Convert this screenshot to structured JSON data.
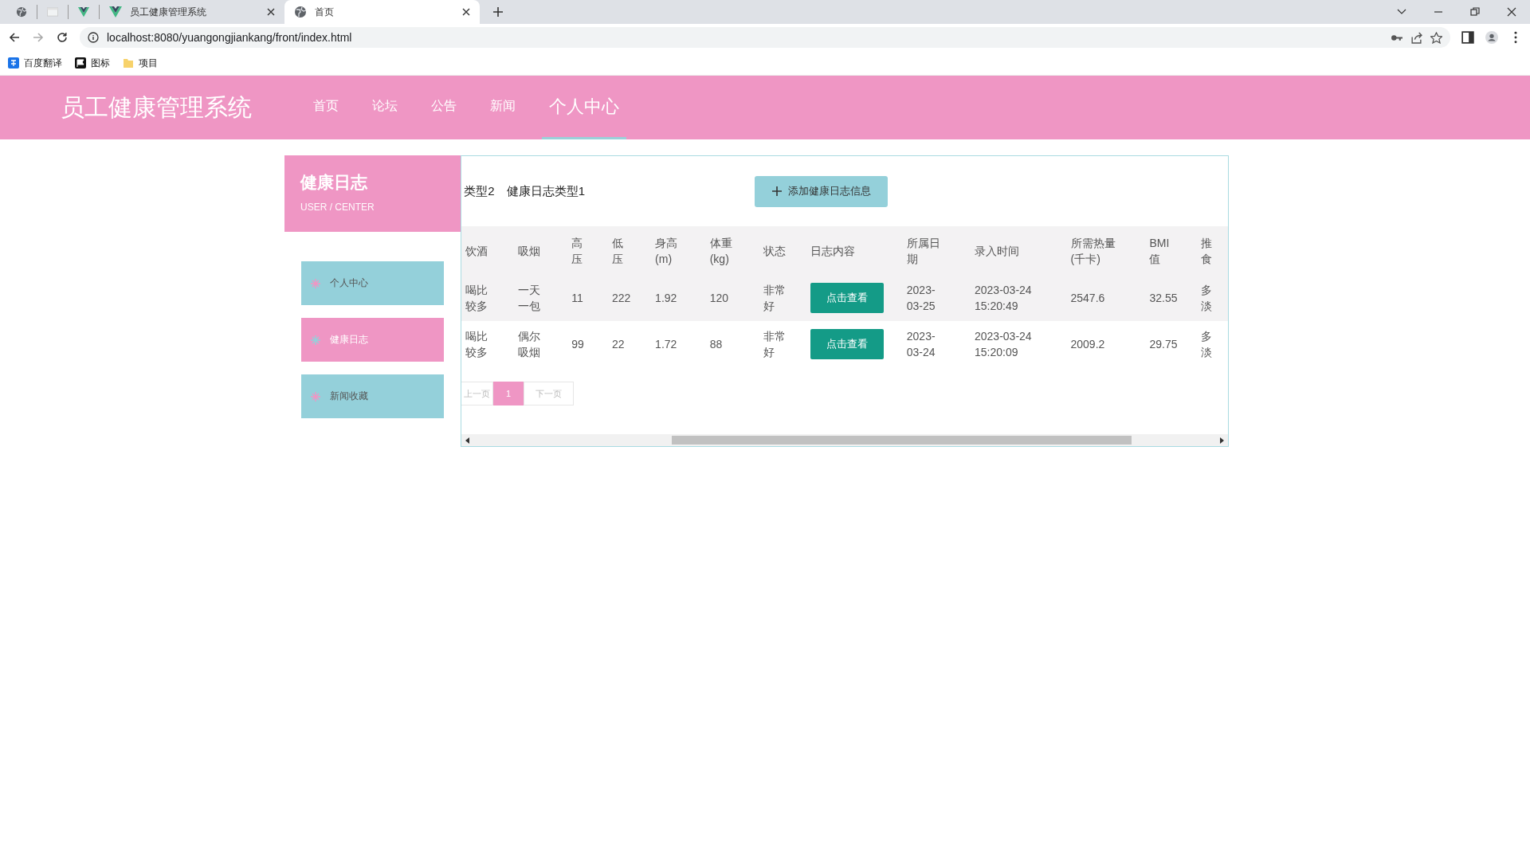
{
  "browser": {
    "tabs": [
      {
        "kind": "globe",
        "selected": false
      },
      {
        "kind": "blank",
        "selected": false
      },
      {
        "kind": "vue",
        "selected": false
      },
      {
        "kind": "vue",
        "title": "员工健康管理系统",
        "selected": false
      },
      {
        "kind": "globe",
        "title": "首页",
        "selected": true
      }
    ],
    "address": "localhost:8080/yuangongjiankang/front/index.html",
    "bookmarks": [
      {
        "kind": "translate",
        "label": "百度翻译"
      },
      {
        "kind": "flag",
        "label": "图标"
      },
      {
        "kind": "folder",
        "label": "项目"
      }
    ]
  },
  "site": {
    "title": "员工健康管理系统",
    "nav": [
      {
        "label": "首页",
        "selected": false
      },
      {
        "label": "论坛",
        "selected": false
      },
      {
        "label": "公告",
        "selected": false
      },
      {
        "label": "新闻",
        "selected": false
      },
      {
        "label": "个人中心",
        "selected": true
      }
    ]
  },
  "sidebar": {
    "title": "健康日志",
    "subtitle": "USER / CENTER",
    "items": [
      {
        "label": "个人中心",
        "selected": false
      },
      {
        "label": "健康日志",
        "selected": true
      },
      {
        "label": "新闻收藏",
        "selected": false
      }
    ]
  },
  "panel": {
    "filters": [
      "类型2",
      "健康日志类型1"
    ],
    "add_button": "添加健康日志信息",
    "table": {
      "columns": [
        {
          "label": "饮酒",
          "kind": "text"
        },
        {
          "label": "吸烟",
          "kind": "text"
        },
        {
          "label": "高压",
          "kind": "text"
        },
        {
          "label": "低压",
          "kind": "text"
        },
        {
          "label": "身高(m)",
          "kind": "text"
        },
        {
          "label": "体重(kg)",
          "kind": "text"
        },
        {
          "label": "状态",
          "kind": "text"
        },
        {
          "label": "日志内容",
          "kind": "button"
        },
        {
          "label": "所属日期",
          "kind": "text"
        },
        {
          "label": "录入时间",
          "kind": "text"
        },
        {
          "label": "所需热量(千卡)",
          "kind": "text"
        },
        {
          "label": "BMI值",
          "kind": "text"
        },
        {
          "label": "推食",
          "kind": "text"
        }
      ],
      "rows": [
        [
          "喝比较多",
          "一天一包",
          "11",
          "222",
          "1.92",
          "120",
          "非常好",
          "点击查看",
          "2023-03-25",
          "2023-03-24 15:20:49",
          "2547.6",
          "32.55",
          "多淡"
        ],
        [
          "喝比较多",
          "偶尔吸烟",
          "99",
          "22",
          "1.72",
          "88",
          "非常好",
          "点击查看",
          "2023-03-24",
          "2023-03-24 15:20:09",
          "2009.2",
          "29.75",
          "多淡"
        ]
      ]
    },
    "pagination": {
      "prev": "上一页",
      "pages": [
        {
          "label": "1",
          "selected": true
        }
      ],
      "next": "下一页"
    }
  }
}
